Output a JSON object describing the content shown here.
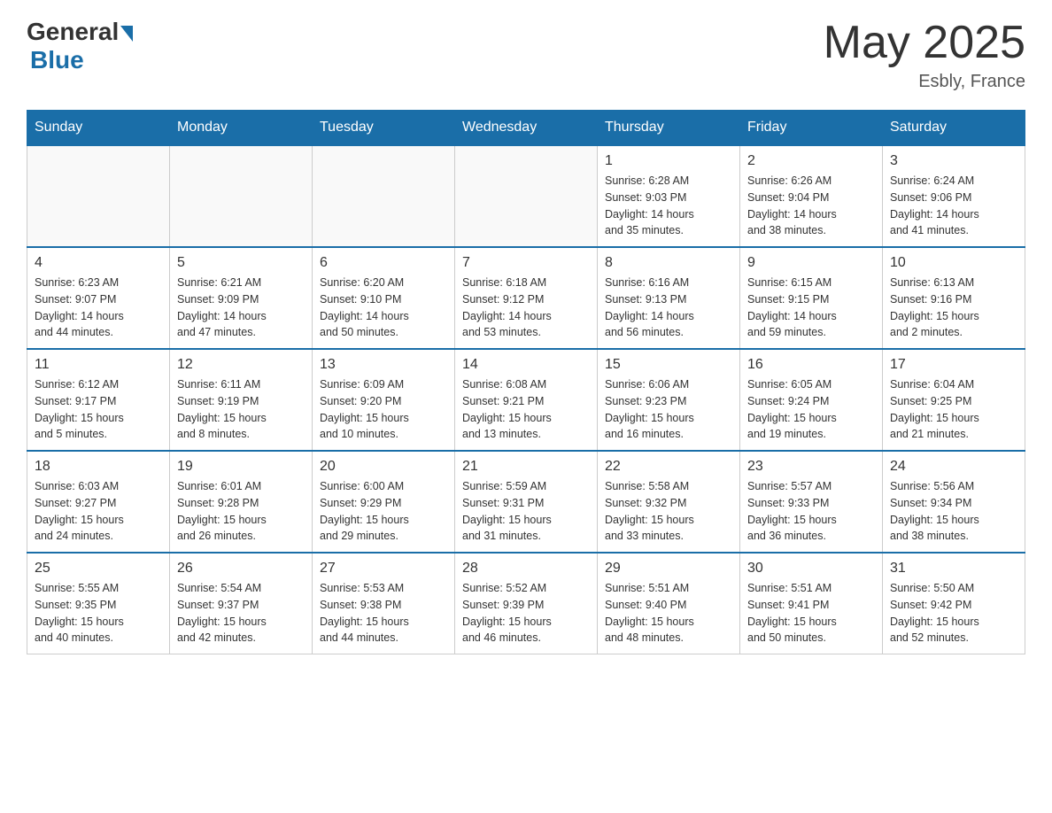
{
  "header": {
    "logo": {
      "general": "General",
      "blue": "Blue",
      "subtitle": "Blue"
    },
    "month_title": "May 2025",
    "location": "Esbly, France"
  },
  "weekdays": [
    "Sunday",
    "Monday",
    "Tuesday",
    "Wednesday",
    "Thursday",
    "Friday",
    "Saturday"
  ],
  "weeks": [
    [
      {
        "day": "",
        "info": ""
      },
      {
        "day": "",
        "info": ""
      },
      {
        "day": "",
        "info": ""
      },
      {
        "day": "",
        "info": ""
      },
      {
        "day": "1",
        "info": "Sunrise: 6:28 AM\nSunset: 9:03 PM\nDaylight: 14 hours\nand 35 minutes."
      },
      {
        "day": "2",
        "info": "Sunrise: 6:26 AM\nSunset: 9:04 PM\nDaylight: 14 hours\nand 38 minutes."
      },
      {
        "day": "3",
        "info": "Sunrise: 6:24 AM\nSunset: 9:06 PM\nDaylight: 14 hours\nand 41 minutes."
      }
    ],
    [
      {
        "day": "4",
        "info": "Sunrise: 6:23 AM\nSunset: 9:07 PM\nDaylight: 14 hours\nand 44 minutes."
      },
      {
        "day": "5",
        "info": "Sunrise: 6:21 AM\nSunset: 9:09 PM\nDaylight: 14 hours\nand 47 minutes."
      },
      {
        "day": "6",
        "info": "Sunrise: 6:20 AM\nSunset: 9:10 PM\nDaylight: 14 hours\nand 50 minutes."
      },
      {
        "day": "7",
        "info": "Sunrise: 6:18 AM\nSunset: 9:12 PM\nDaylight: 14 hours\nand 53 minutes."
      },
      {
        "day": "8",
        "info": "Sunrise: 6:16 AM\nSunset: 9:13 PM\nDaylight: 14 hours\nand 56 minutes."
      },
      {
        "day": "9",
        "info": "Sunrise: 6:15 AM\nSunset: 9:15 PM\nDaylight: 14 hours\nand 59 minutes."
      },
      {
        "day": "10",
        "info": "Sunrise: 6:13 AM\nSunset: 9:16 PM\nDaylight: 15 hours\nand 2 minutes."
      }
    ],
    [
      {
        "day": "11",
        "info": "Sunrise: 6:12 AM\nSunset: 9:17 PM\nDaylight: 15 hours\nand 5 minutes."
      },
      {
        "day": "12",
        "info": "Sunrise: 6:11 AM\nSunset: 9:19 PM\nDaylight: 15 hours\nand 8 minutes."
      },
      {
        "day": "13",
        "info": "Sunrise: 6:09 AM\nSunset: 9:20 PM\nDaylight: 15 hours\nand 10 minutes."
      },
      {
        "day": "14",
        "info": "Sunrise: 6:08 AM\nSunset: 9:21 PM\nDaylight: 15 hours\nand 13 minutes."
      },
      {
        "day": "15",
        "info": "Sunrise: 6:06 AM\nSunset: 9:23 PM\nDaylight: 15 hours\nand 16 minutes."
      },
      {
        "day": "16",
        "info": "Sunrise: 6:05 AM\nSunset: 9:24 PM\nDaylight: 15 hours\nand 19 minutes."
      },
      {
        "day": "17",
        "info": "Sunrise: 6:04 AM\nSunset: 9:25 PM\nDaylight: 15 hours\nand 21 minutes."
      }
    ],
    [
      {
        "day": "18",
        "info": "Sunrise: 6:03 AM\nSunset: 9:27 PM\nDaylight: 15 hours\nand 24 minutes."
      },
      {
        "day": "19",
        "info": "Sunrise: 6:01 AM\nSunset: 9:28 PM\nDaylight: 15 hours\nand 26 minutes."
      },
      {
        "day": "20",
        "info": "Sunrise: 6:00 AM\nSunset: 9:29 PM\nDaylight: 15 hours\nand 29 minutes."
      },
      {
        "day": "21",
        "info": "Sunrise: 5:59 AM\nSunset: 9:31 PM\nDaylight: 15 hours\nand 31 minutes."
      },
      {
        "day": "22",
        "info": "Sunrise: 5:58 AM\nSunset: 9:32 PM\nDaylight: 15 hours\nand 33 minutes."
      },
      {
        "day": "23",
        "info": "Sunrise: 5:57 AM\nSunset: 9:33 PM\nDaylight: 15 hours\nand 36 minutes."
      },
      {
        "day": "24",
        "info": "Sunrise: 5:56 AM\nSunset: 9:34 PM\nDaylight: 15 hours\nand 38 minutes."
      }
    ],
    [
      {
        "day": "25",
        "info": "Sunrise: 5:55 AM\nSunset: 9:35 PM\nDaylight: 15 hours\nand 40 minutes."
      },
      {
        "day": "26",
        "info": "Sunrise: 5:54 AM\nSunset: 9:37 PM\nDaylight: 15 hours\nand 42 minutes."
      },
      {
        "day": "27",
        "info": "Sunrise: 5:53 AM\nSunset: 9:38 PM\nDaylight: 15 hours\nand 44 minutes."
      },
      {
        "day": "28",
        "info": "Sunrise: 5:52 AM\nSunset: 9:39 PM\nDaylight: 15 hours\nand 46 minutes."
      },
      {
        "day": "29",
        "info": "Sunrise: 5:51 AM\nSunset: 9:40 PM\nDaylight: 15 hours\nand 48 minutes."
      },
      {
        "day": "30",
        "info": "Sunrise: 5:51 AM\nSunset: 9:41 PM\nDaylight: 15 hours\nand 50 minutes."
      },
      {
        "day": "31",
        "info": "Sunrise: 5:50 AM\nSunset: 9:42 PM\nDaylight: 15 hours\nand 52 minutes."
      }
    ]
  ]
}
